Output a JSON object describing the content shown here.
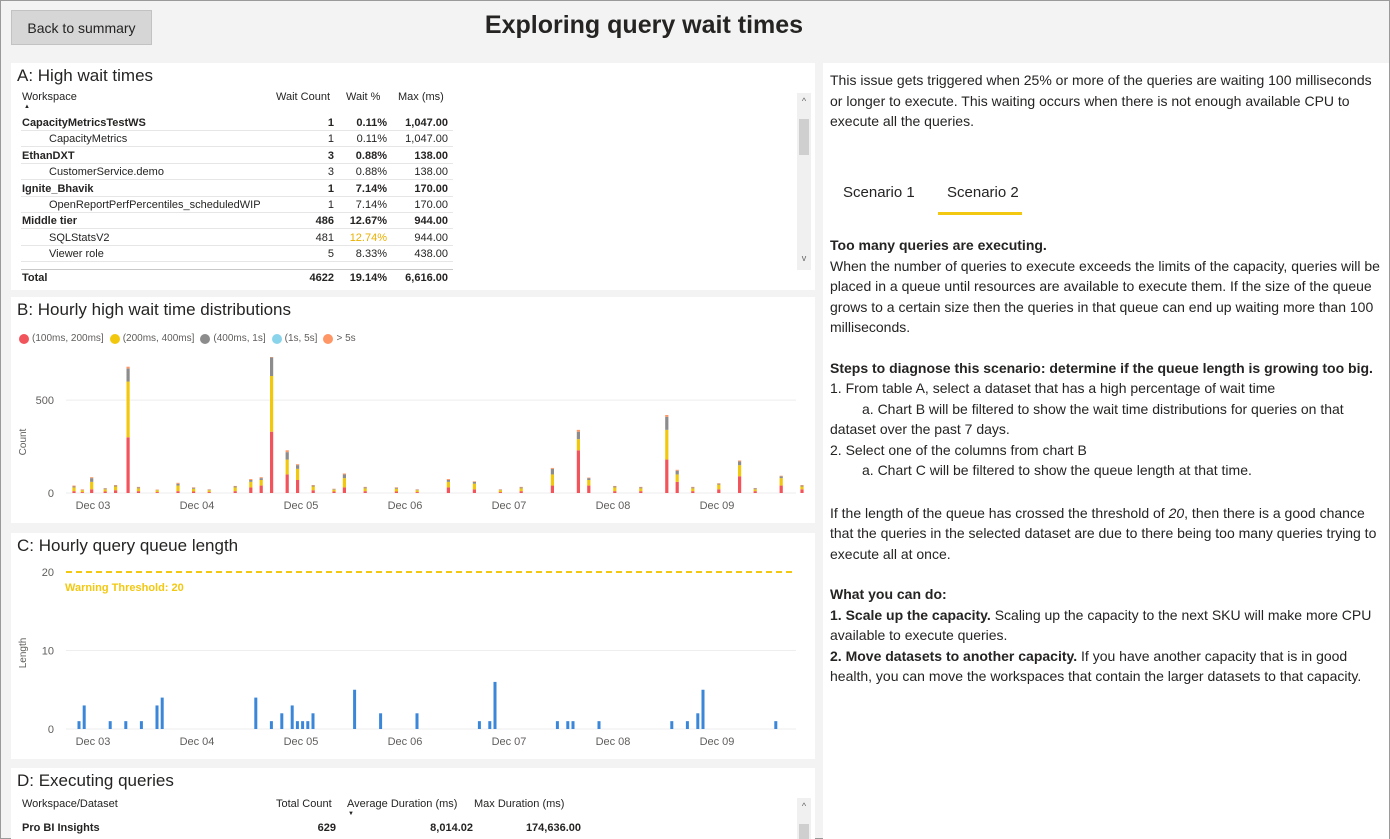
{
  "header": {
    "back_label": "Back to summary",
    "title": "Exploring query wait times"
  },
  "panelA": {
    "title": "A: High wait times",
    "columns": [
      "Workspace",
      "Wait Count",
      "Wait %",
      "Max (ms)"
    ],
    "rows": [
      {
        "name": "CapacityMetricsTestWS",
        "count": "1",
        "pct": "0.11%",
        "max": "1,047.00",
        "bold": true,
        "indent": false,
        "hl": false
      },
      {
        "name": "CapacityMetrics",
        "count": "1",
        "pct": "0.11%",
        "max": "1,047.00",
        "bold": false,
        "indent": true,
        "hl": false
      },
      {
        "name": "EthanDXT",
        "count": "3",
        "pct": "0.88%",
        "max": "138.00",
        "bold": true,
        "indent": false,
        "hl": false
      },
      {
        "name": "CustomerService.demo",
        "count": "3",
        "pct": "0.88%",
        "max": "138.00",
        "bold": false,
        "indent": true,
        "hl": false
      },
      {
        "name": "Ignite_Bhavik",
        "count": "1",
        "pct": "7.14%",
        "max": "170.00",
        "bold": true,
        "indent": false,
        "hl": false
      },
      {
        "name": "OpenReportPerfPercentiles_scheduledWIP",
        "count": "1",
        "pct": "7.14%",
        "max": "170.00",
        "bold": false,
        "indent": true,
        "hl": false
      },
      {
        "name": "Middle tier",
        "count": "486",
        "pct": "12.67%",
        "max": "944.00",
        "bold": true,
        "indent": false,
        "hl": false
      },
      {
        "name": "SQLStatsV2",
        "count": "481",
        "pct": "12.74%",
        "max": "944.00",
        "bold": false,
        "indent": true,
        "hl": true
      },
      {
        "name": "Viewer role",
        "count": "5",
        "pct": "8.33%",
        "max": "438.00",
        "bold": false,
        "indent": true,
        "hl": false
      }
    ],
    "total": {
      "name": "Total",
      "count": "4622",
      "pct": "19.14%",
      "max": "6,616.00"
    }
  },
  "panelB": {
    "title": "B: Hourly high wait time distributions",
    "legend": [
      {
        "label": "(100ms, 200ms]",
        "color": "#f2545b"
      },
      {
        "label": "(200ms, 400ms]",
        "color": "#f2c80f"
      },
      {
        "label": "(400ms, 1s]",
        "color": "#8c8c8c"
      },
      {
        "label": "(1s, 5s]",
        "color": "#8ad4eb"
      },
      {
        "label": "> 5s",
        "color": "#fe9666"
      }
    ],
    "ylabel": "Count",
    "yticks": [
      "500",
      "0"
    ],
    "xticks": [
      "Dec 03",
      "Dec 04",
      "Dec 05",
      "Dec 06",
      "Dec 07",
      "Dec 08",
      "Dec 09"
    ]
  },
  "panelC": {
    "title": "C: Hourly query queue length",
    "ylabel": "Length",
    "yticks": [
      "20",
      "10",
      "0"
    ],
    "threshold_label": "Warning Threshold: 20",
    "xticks": [
      "Dec 03",
      "Dec 04",
      "Dec 05",
      "Dec 06",
      "Dec 07",
      "Dec 08",
      "Dec 09"
    ]
  },
  "panelD": {
    "title": "D: Executing queries",
    "columns": [
      "Workspace/Dataset",
      "Total Count",
      "Average Duration (ms)",
      "Max Duration (ms)"
    ],
    "rows": [
      {
        "name": "Pro BI Insights",
        "count": "629",
        "avg": "8,014.02",
        "max": "174,636.00"
      }
    ]
  },
  "right": {
    "intro": "This issue gets triggered when 25% or more of the queries are waiting 100 milliseconds or longer to execute.  This waiting occurs when there is not enough available CPU to execute all the queries.",
    "tab1": "Scenario 1",
    "tab2": "Scenario 2",
    "heading1": "Too many queries are executing.",
    "para1": "When the number of queries to execute exceeds the limits of the capacity, queries will be placed in a queue until resources are available to execute them.  If the size of the queue grows to a certain size then the queries in that queue can end up waiting more than 100 milliseconds.",
    "heading2": "Steps to diagnose this scenario: determine if the queue length is growing too big.",
    "step1": "1.  From table A, select a dataset that has a high percentage of wait time",
    "step1a": "a.  Chart B will be filtered to show the wait time distributions for queries on that dataset over the past 7 days.",
    "step2": "2.  Select one of the columns from chart B",
    "step2a": "a.  Chart C will be filtered to show the queue length at that time.",
    "para2_pre": "If the length of the queue has crossed the threshold of ",
    "para2_num": "20",
    "para2_post": ", then there is a good chance that the queries in the selected dataset are due to there being too many queries trying to execute all at once.",
    "heading3": "What you can do:",
    "do1_bold": "1.  Scale up the capacity.",
    "do1_text": "  Scaling up the capacity to the next SKU will make more CPU available to execute queries.",
    "do2_bold": "2.  Move datasets to another capacity.",
    "do2_text": "  If you have another capacity that is in good health, you can move the workspaces that contain the larger datasets to that capacity."
  },
  "chart_data": [
    {
      "type": "bar",
      "title": "B: Hourly high wait time distributions",
      "xlabel": "",
      "ylabel": "Count",
      "ylim": [
        0,
        700
      ],
      "stacked": true,
      "x_categories": [
        "Dec 03",
        "Dec 04",
        "Dec 05",
        "Dec 06",
        "Dec 07",
        "Dec 08",
        "Dec 09"
      ],
      "legend_position": "top-left",
      "bars": [
        {
          "x": 0.0,
          "v": [
            10,
            20,
            5,
            0,
            5
          ]
        },
        {
          "x": 0.08,
          "v": [
            5,
            10,
            2,
            0,
            3
          ]
        },
        {
          "x": 0.17,
          "v": [
            20,
            40,
            20,
            0,
            5
          ]
        },
        {
          "x": 0.3,
          "v": [
            8,
            12,
            4,
            0,
            2
          ]
        },
        {
          "x": 0.4,
          "v": [
            15,
            20,
            5,
            0,
            3
          ]
        },
        {
          "x": 0.52,
          "v": [
            300,
            300,
            70,
            0,
            10
          ]
        },
        {
          "x": 0.62,
          "v": [
            10,
            15,
            5,
            0,
            3
          ]
        },
        {
          "x": 0.8,
          "v": [
            5,
            10,
            2,
            0,
            2
          ]
        },
        {
          "x": 1.0,
          "v": [
            10,
            30,
            10,
            0,
            5
          ]
        },
        {
          "x": 1.15,
          "v": [
            8,
            15,
            5,
            0,
            3
          ]
        },
        {
          "x": 1.3,
          "v": [
            5,
            10,
            3,
            0,
            2
          ]
        },
        {
          "x": 1.55,
          "v": [
            10,
            20,
            5,
            0,
            3
          ]
        },
        {
          "x": 1.7,
          "v": [
            30,
            30,
            10,
            0,
            5
          ]
        },
        {
          "x": 1.8,
          "v": [
            40,
            30,
            10,
            0,
            5
          ]
        },
        {
          "x": 1.9,
          "v": [
            330,
            300,
            100,
            0,
            10
          ]
        },
        {
          "x": 2.05,
          "v": [
            100,
            80,
            40,
            0,
            10
          ]
        },
        {
          "x": 2.15,
          "v": [
            70,
            60,
            20,
            0,
            5
          ]
        },
        {
          "x": 2.3,
          "v": [
            15,
            20,
            5,
            0,
            3
          ]
        },
        {
          "x": 2.5,
          "v": [
            8,
            10,
            3,
            0,
            2
          ]
        },
        {
          "x": 2.6,
          "v": [
            30,
            50,
            20,
            0,
            5
          ]
        },
        {
          "x": 2.8,
          "v": [
            10,
            15,
            5,
            0,
            3
          ]
        },
        {
          "x": 3.1,
          "v": [
            8,
            15,
            5,
            0,
            3
          ]
        },
        {
          "x": 3.3,
          "v": [
            5,
            10,
            3,
            0,
            2
          ]
        },
        {
          "x": 3.6,
          "v": [
            30,
            30,
            10,
            0,
            5
          ]
        },
        {
          "x": 3.85,
          "v": [
            20,
            30,
            10,
            0,
            3
          ]
        },
        {
          "x": 4.1,
          "v": [
            5,
            10,
            3,
            0,
            2
          ]
        },
        {
          "x": 4.3,
          "v": [
            10,
            15,
            5,
            0,
            3
          ]
        },
        {
          "x": 4.6,
          "v": [
            40,
            60,
            30,
            0,
            5
          ]
        },
        {
          "x": 4.85,
          "v": [
            230,
            60,
            40,
            0,
            10
          ]
        },
        {
          "x": 4.95,
          "v": [
            40,
            30,
            10,
            0,
            3
          ]
        },
        {
          "x": 5.2,
          "v": [
            10,
            20,
            5,
            0,
            3
          ]
        },
        {
          "x": 5.45,
          "v": [
            10,
            15,
            5,
            0,
            3
          ]
        },
        {
          "x": 5.7,
          "v": [
            180,
            160,
            70,
            0,
            10
          ]
        },
        {
          "x": 5.8,
          "v": [
            60,
            40,
            20,
            0,
            5
          ]
        },
        {
          "x": 5.95,
          "v": [
            10,
            15,
            5,
            0,
            3
          ]
        },
        {
          "x": 6.2,
          "v": [
            20,
            25,
            5,
            0,
            3
          ]
        },
        {
          "x": 6.4,
          "v": [
            90,
            60,
            20,
            0,
            5
          ]
        },
        {
          "x": 6.55,
          "v": [
            10,
            10,
            5,
            0,
            2
          ]
        },
        {
          "x": 6.8,
          "v": [
            40,
            40,
            10,
            0,
            3
          ]
        },
        {
          "x": 7.0,
          "v": [
            20,
            15,
            5,
            0,
            3
          ]
        }
      ]
    },
    {
      "type": "bar",
      "title": "C: Hourly query queue length",
      "xlabel": "",
      "ylabel": "Length",
      "ylim": [
        0,
        20
      ],
      "threshold": 20,
      "x_categories": [
        "Dec 03",
        "Dec 04",
        "Dec 05",
        "Dec 06",
        "Dec 07",
        "Dec 08",
        "Dec 09"
      ],
      "bars": [
        {
          "x": 0.0,
          "v": 1
        },
        {
          "x": 0.05,
          "v": 3
        },
        {
          "x": 0.3,
          "v": 1
        },
        {
          "x": 0.45,
          "v": 1
        },
        {
          "x": 0.6,
          "v": 1
        },
        {
          "x": 0.75,
          "v": 3
        },
        {
          "x": 0.8,
          "v": 4
        },
        {
          "x": 1.7,
          "v": 4
        },
        {
          "x": 1.85,
          "v": 1
        },
        {
          "x": 1.95,
          "v": 2
        },
        {
          "x": 2.05,
          "v": 3
        },
        {
          "x": 2.1,
          "v": 1
        },
        {
          "x": 2.15,
          "v": 1
        },
        {
          "x": 2.2,
          "v": 1
        },
        {
          "x": 2.25,
          "v": 2
        },
        {
          "x": 2.65,
          "v": 5
        },
        {
          "x": 2.9,
          "v": 2
        },
        {
          "x": 3.25,
          "v": 2
        },
        {
          "x": 3.85,
          "v": 1
        },
        {
          "x": 3.95,
          "v": 1
        },
        {
          "x": 4.0,
          "v": 6
        },
        {
          "x": 4.6,
          "v": 1
        },
        {
          "x": 4.7,
          "v": 1
        },
        {
          "x": 4.75,
          "v": 1
        },
        {
          "x": 5.0,
          "v": 1
        },
        {
          "x": 5.7,
          "v": 1
        },
        {
          "x": 5.85,
          "v": 1
        },
        {
          "x": 5.95,
          "v": 2
        },
        {
          "x": 6.0,
          "v": 5
        },
        {
          "x": 6.7,
          "v": 1
        }
      ]
    }
  ]
}
